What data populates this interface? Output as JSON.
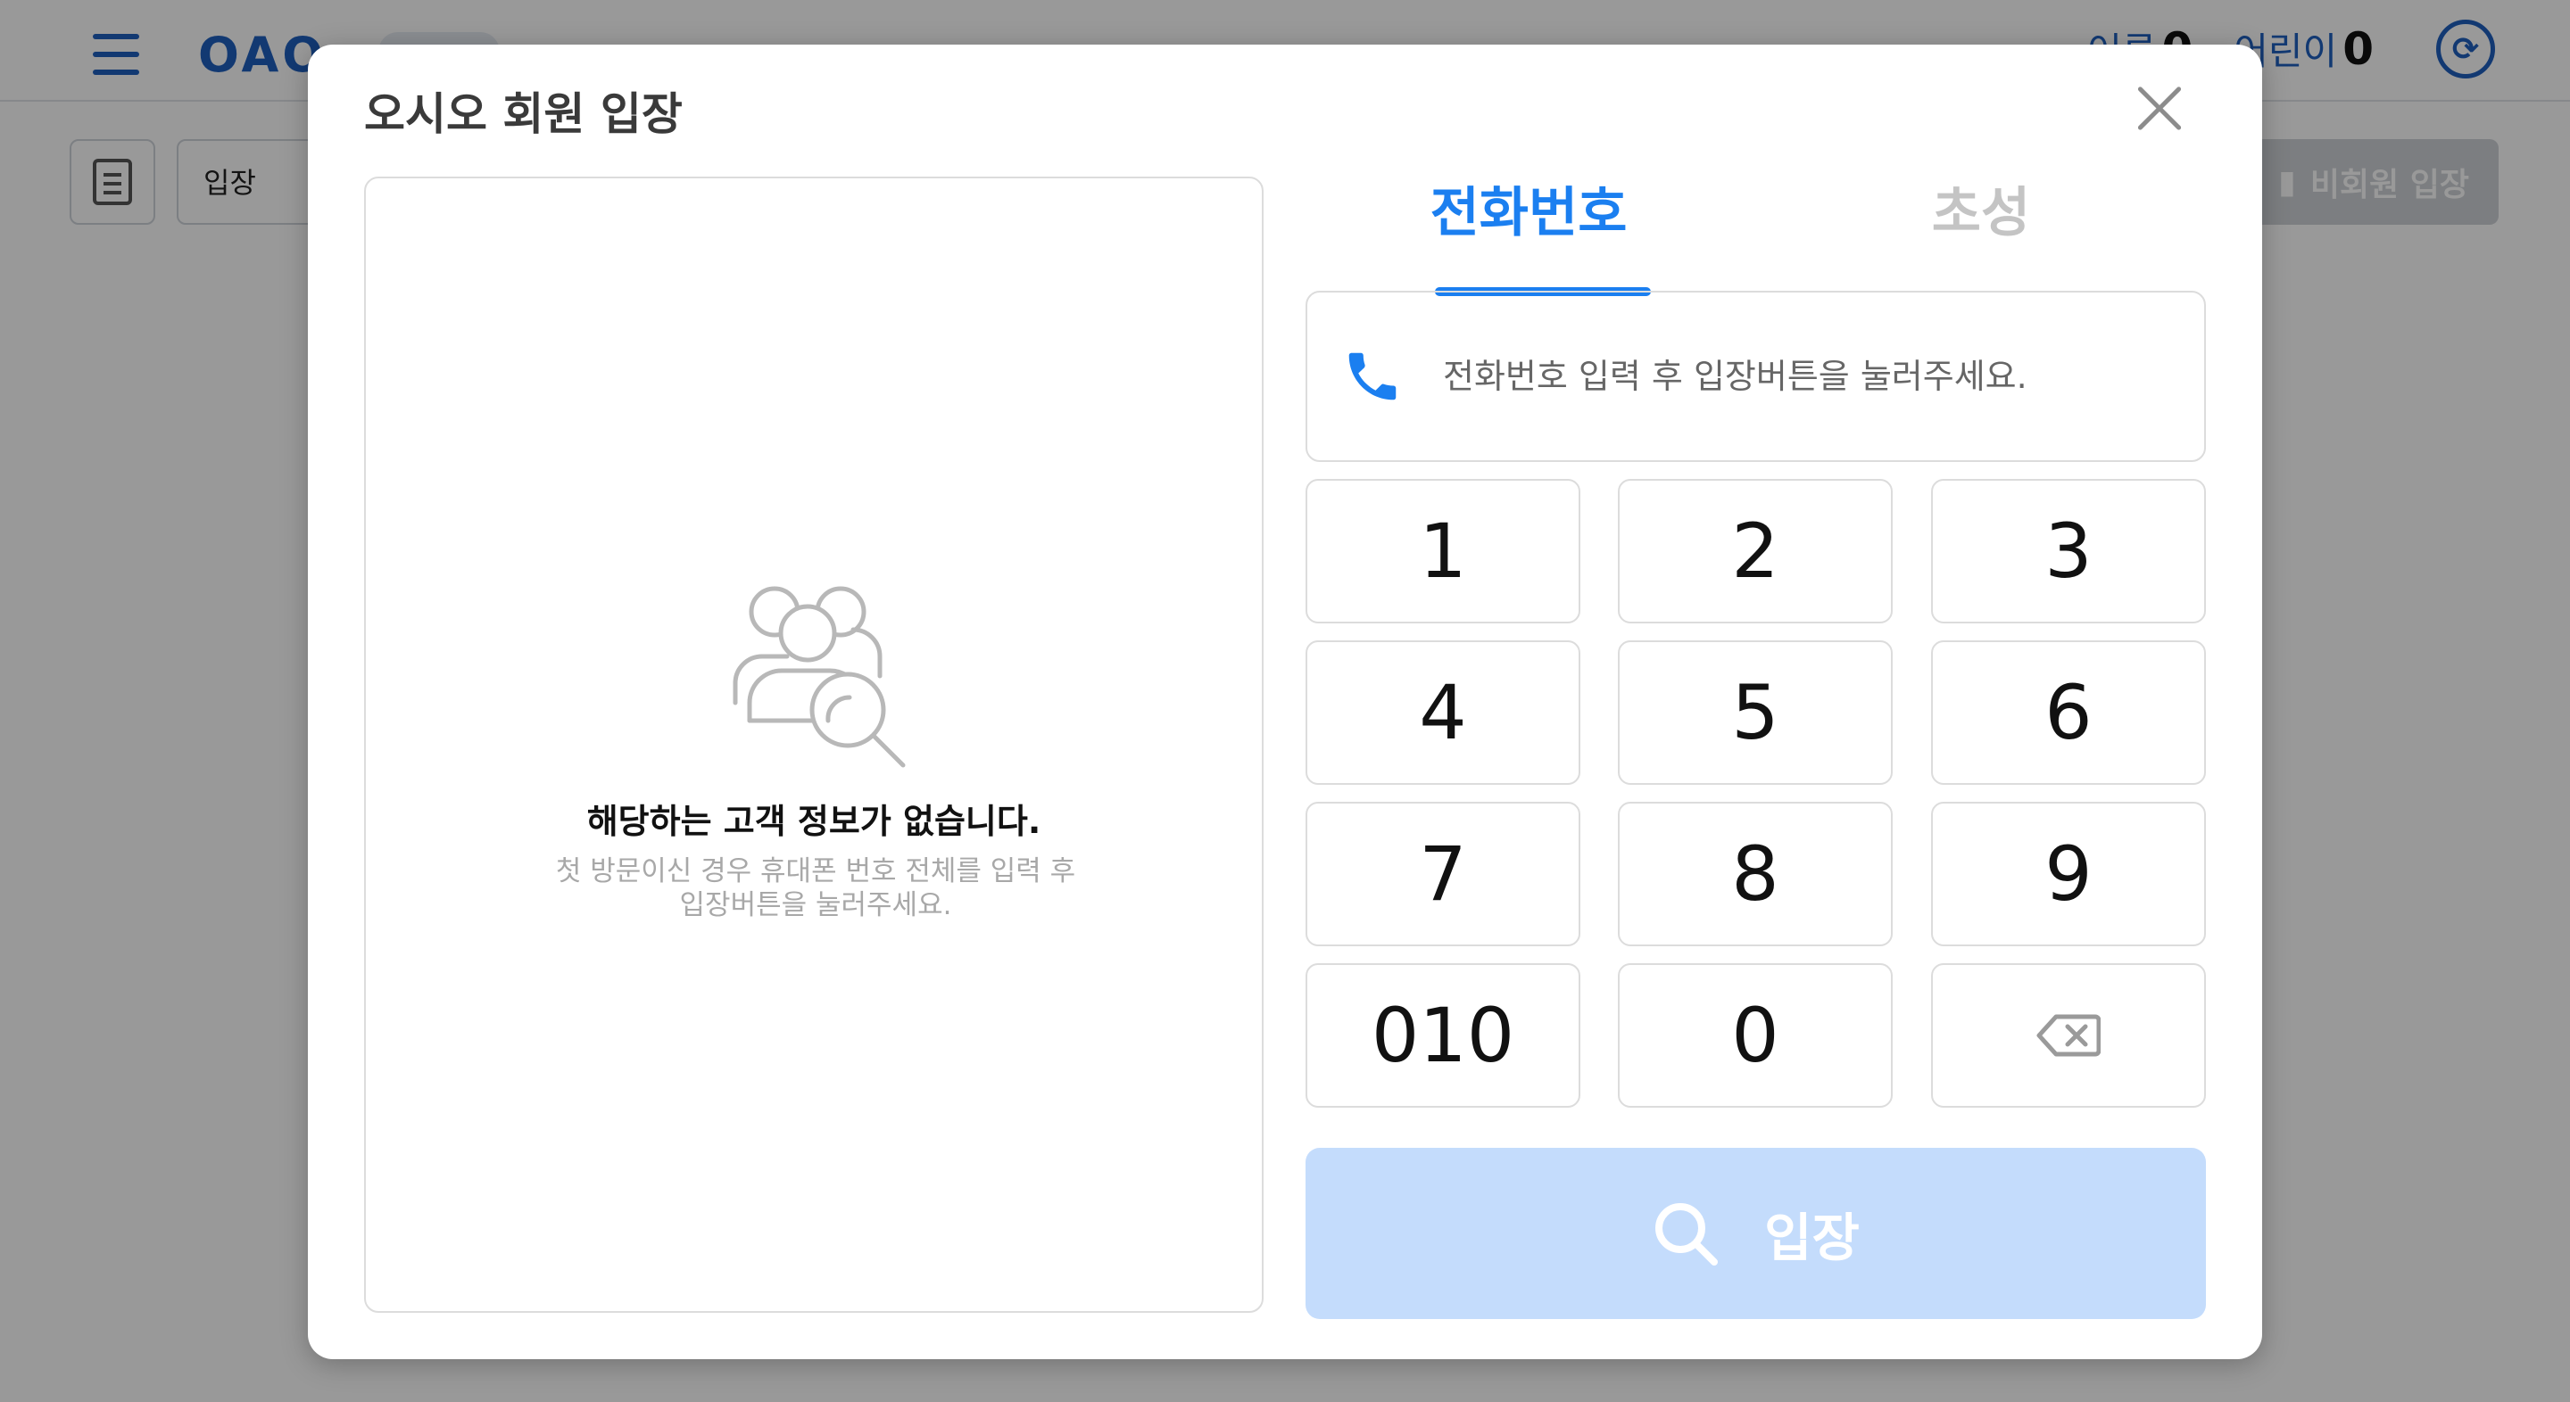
{
  "app": {
    "brand": "OAO",
    "counters": [
      {
        "label": "어른",
        "value": "0"
      },
      {
        "label": "어린이",
        "value": "0"
      }
    ],
    "toolbar": {
      "entry_select": "입장",
      "nonmember_label": "비회원 입장"
    }
  },
  "modal": {
    "title": "오시오 회원 입장",
    "tabs": [
      {
        "label": "전화번호",
        "active": true
      },
      {
        "label": "초성",
        "active": false
      }
    ],
    "phone_input": {
      "value": "",
      "placeholder": "전화번호 입력 후 입장버튼을 눌러주세요."
    },
    "empty_state": {
      "title": "해당하는 고객 정보가 없습니다.",
      "description": "첫 방문이신 경우 휴대폰 번호 전체를 입력 후 입장버튼을 눌러주세요."
    },
    "keypad": [
      "1",
      "2",
      "3",
      "4",
      "5",
      "6",
      "7",
      "8",
      "9",
      "010",
      "0",
      "backspace"
    ],
    "enter_label": "입장"
  },
  "colors": {
    "accent": "#1b7ff0",
    "brand": "#1f5fbf",
    "enter_disabled": "#c4dcfc",
    "overlay": "rgba(0,0,0,0.4)"
  },
  "icons": [
    "menu-icon",
    "refresh-icon",
    "calendar-icon",
    "door-icon",
    "close-icon",
    "phone-icon",
    "customer-search-icon",
    "backspace-icon",
    "search-icon"
  ]
}
